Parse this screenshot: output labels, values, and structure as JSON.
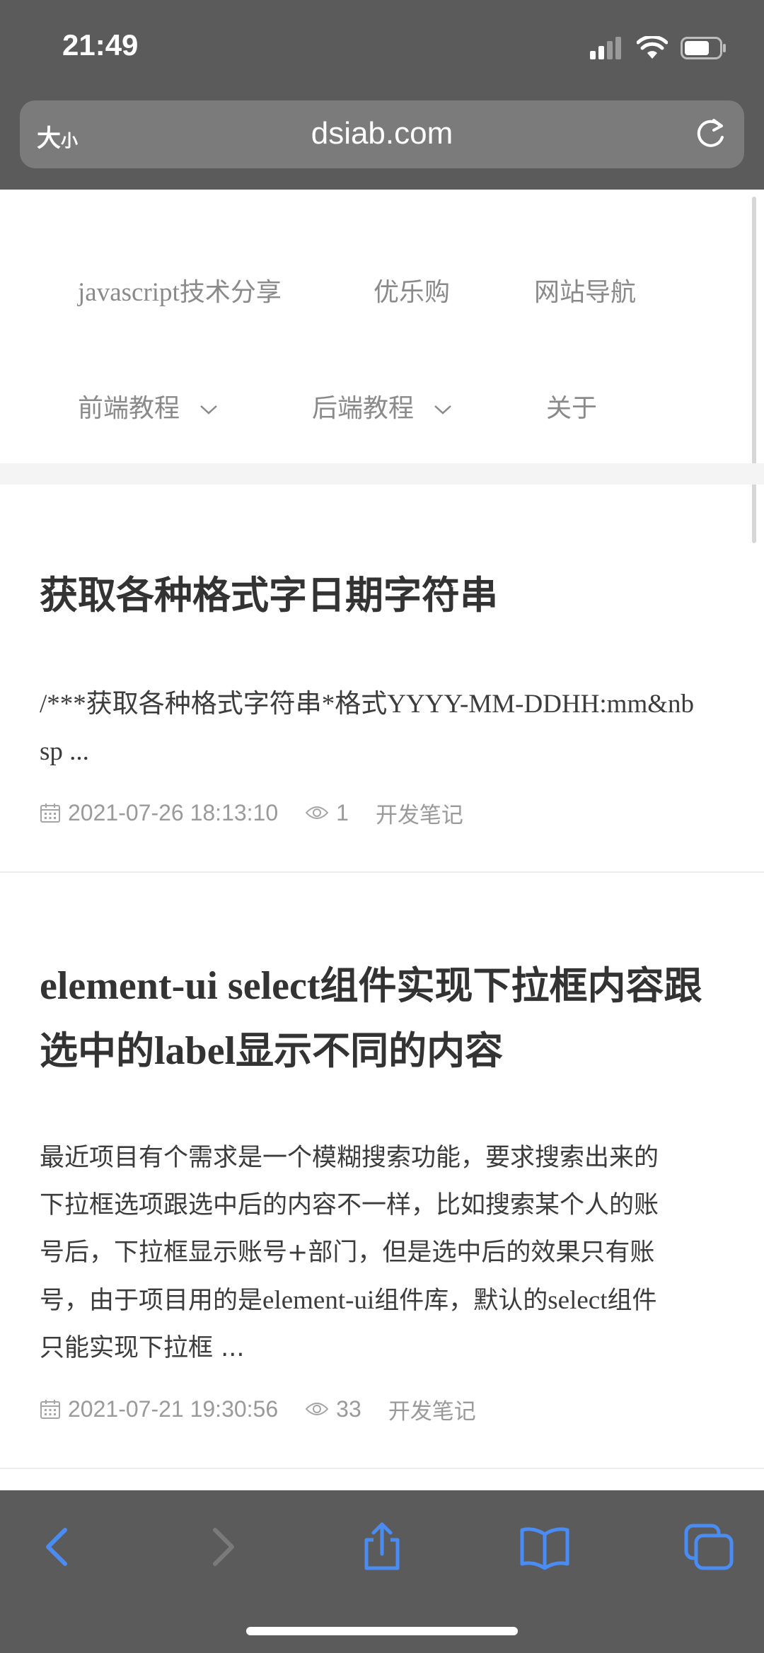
{
  "status_bar": {
    "time": "21:49"
  },
  "browser": {
    "text_size_label": "大",
    "text_size_label_small": "小",
    "url": "dsiab.com"
  },
  "nav": {
    "items": [
      {
        "label_latin": "javascript",
        "label": "技术分享"
      },
      {
        "label": "优乐购"
      },
      {
        "label": "网站导航"
      },
      {
        "label": "前端教程"
      },
      {
        "label": "后端教程"
      },
      {
        "label": "关于"
      }
    ]
  },
  "articles": [
    {
      "title": "获取各种格式字日期字符串",
      "excerpt_part1": "/***获取各种格式字符串*格式YYYY-MM-DDHH:mm&nb",
      "excerpt_part2": "sp ...",
      "date": "2021-07-26 18:13:10",
      "views": "1",
      "category": "开发笔记"
    },
    {
      "title_part1": "element-ui select",
      "title_part2": "组件实现下拉框内容跟",
      "title_part3": "选中的",
      "title_part4": "label",
      "title_part5": "显示不同的内容",
      "excerpt_line1": "最近项目有个需求是一个模糊搜索功能，要求搜索出来的",
      "excerpt_line2": "下拉框选项跟选中后的内容不一样，比如搜索某个人的账",
      "excerpt_line3": "号后，下拉框显示账号+部门，但是选中后的效果只有账",
      "excerpt_line4a": "号，由于项目用的是",
      "excerpt_line4b": "element-ui",
      "excerpt_line4c": "组件库，默认的",
      "excerpt_line4d": "select",
      "excerpt_line4e": "组件",
      "excerpt_line5": "只能实现下拉框 ...",
      "date": "2021-07-21 19:30:56",
      "views": "33",
      "category": "开发笔记"
    }
  ],
  "colors": {
    "chrome": "#5b5b5b",
    "address_bar": "#7b7b7b",
    "toolbar_icon": "#4a8cf2",
    "toolbar_icon_disabled": "#7a7a7a"
  },
  "icons": [
    "cellular-signal-icon",
    "wifi-icon",
    "battery-icon",
    "reload-icon",
    "calendar-icon",
    "eye-icon",
    "chevron-down-icon",
    "back-icon",
    "forward-icon",
    "share-icon",
    "bookmarks-icon",
    "tabs-icon"
  ]
}
